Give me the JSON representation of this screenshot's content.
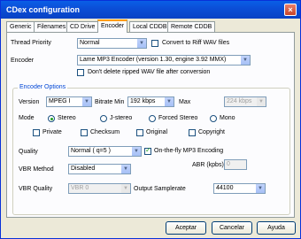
{
  "window": {
    "title": "CDex configuration",
    "close_label": "×"
  },
  "tabs": [
    {
      "label": "Generic"
    },
    {
      "label": "Filenames"
    },
    {
      "label": "CD Drive"
    },
    {
      "label": "Encoder"
    },
    {
      "label": "Local CDDB"
    },
    {
      "label": "Remote CDDB"
    }
  ],
  "encoder": {
    "thread_priority_label": "Thread Priority",
    "thread_priority_value": "Normal",
    "convert_riff_label": "Convert to Riff WAV files",
    "encoder_label": "Encoder",
    "encoder_value": "Lame MP3 Encoder (version 1.30, engine 3.92 MMX)",
    "dont_delete_label": "Don't delete ripped WAV file after conversion"
  },
  "options": {
    "group_title": "Encoder Options",
    "version_label": "Version",
    "version_value": "MPEG I",
    "bitrate_min_label": "Bitrate Min",
    "bitrate_min_value": "192 kbps",
    "max_label": "Max",
    "max_value": "224 kbps",
    "mode_label": "Mode",
    "mode_stereo": "Stereo",
    "mode_jstereo": "J-stereo",
    "mode_forced": "Forced Stereo",
    "mode_mono": "Mono",
    "private_label": "Private",
    "checksum_label": "Checksum",
    "original_label": "Original",
    "copyright_label": "Copyright",
    "quality_label": "Quality",
    "quality_value": "Normal ( q=5 )",
    "onthefly_label": "On-the-fly MP3 Encoding",
    "vbr_method_label": "VBR Method",
    "vbr_method_value": "Disabled",
    "abr_label": "ABR (kpbs)",
    "abr_value": "0",
    "vbr_quality_label": "VBR Quality",
    "vbr_quality_value": "VBR 0",
    "output_samplerate_label": "Output Samplerate",
    "output_samplerate_value": "44100"
  },
  "buttons": {
    "ok": "Aceptar",
    "cancel": "Cancelar",
    "help": "Ayuda"
  },
  "colors": {
    "titlebar": "#0b4fd8",
    "group_title": "#0046d5",
    "check": "#21a121"
  }
}
